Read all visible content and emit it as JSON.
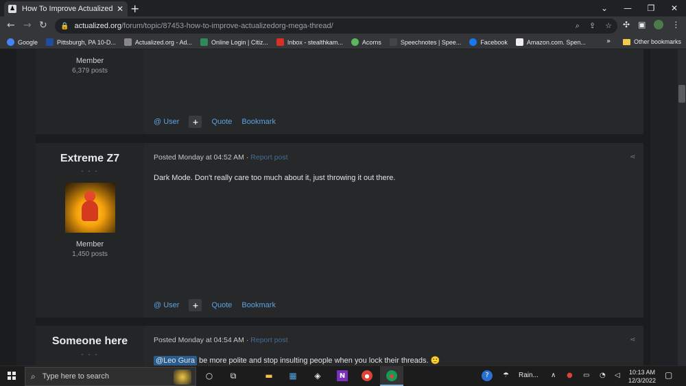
{
  "browser": {
    "tab_title": "How To Improve Actualized.org",
    "url_host": "actualized.org",
    "url_path": "/forum/topic/87453-how-to-improve-actualizedorg-mega-thread/",
    "bookmarks": [
      {
        "label": "Google",
        "color": "#4285f4"
      },
      {
        "label": "Pittsburgh, PA 10-D...",
        "color": "#1f4ea1"
      },
      {
        "label": "Actualized.org - Ad...",
        "color": "#888888"
      },
      {
        "label": "Online Login | Citiz...",
        "color": "#2e8b57"
      },
      {
        "label": "Inbox - stealthkam...",
        "color": "#d93025"
      },
      {
        "label": "Acorns",
        "color": "#5bb85d"
      },
      {
        "label": "Speechnotes | Spee...",
        "color": "#444444"
      },
      {
        "label": "Facebook",
        "color": "#1877f2"
      },
      {
        "label": "Amazon.com. Spen...",
        "color": "#eeeeee"
      }
    ],
    "bookmarks_more": "»",
    "other_bookmarks": "Other bookmarks"
  },
  "posts": [
    {
      "member_title": "Member",
      "posts_count": "6,379 posts",
      "actions": {
        "user": "@ User",
        "plus": "+",
        "quote": "Quote",
        "bookmark": "Bookmark"
      }
    },
    {
      "author": "Extreme Z7",
      "dashes": "- - -",
      "member_title": "Member",
      "posts_count": "1,450 posts",
      "posted": "Posted Monday at 04:52 AM",
      "separator": " · ",
      "report": "Report post",
      "body": "Dark Mode. Don't really care too much about it, just throwing it out there.",
      "actions": {
        "user": "@ User",
        "plus": "+",
        "quote": "Quote",
        "bookmark": "Bookmark"
      }
    },
    {
      "author": "Someone here",
      "dashes": "- - -",
      "posted": "Posted Monday at 04:54 AM",
      "separator": " · ",
      "report": "Report post",
      "mention": "@Leo Gura",
      "body": " be more polite and stop insulting people when you lock their threads. 🙂"
    }
  ],
  "taskbar": {
    "search_placeholder": "Type here to search",
    "weather": "Rain...",
    "time": "10:13 AM",
    "date": "12/3/2022"
  }
}
